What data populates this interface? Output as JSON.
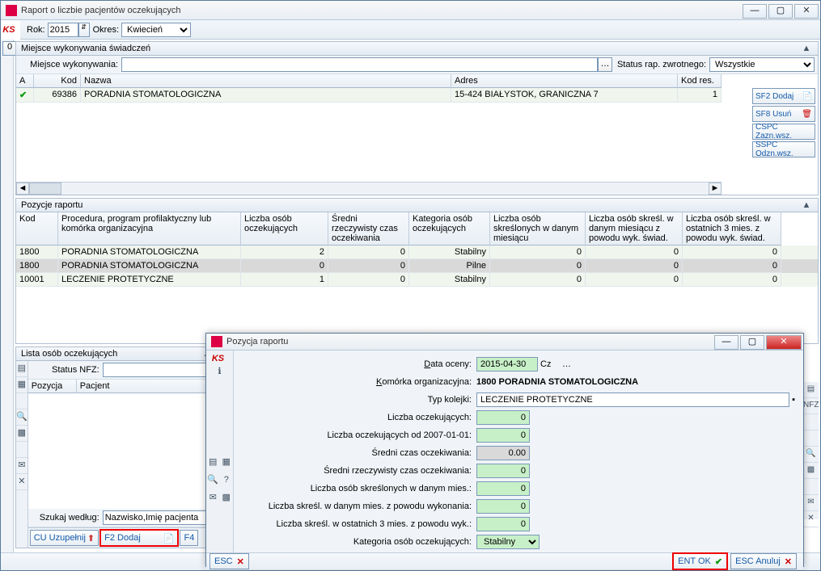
{
  "mainWindow": {
    "title": "Raport o liczbie pacjentów oczekujących"
  },
  "toolbar": {
    "rokLabel": "Rok:",
    "rok": "2015",
    "okresLabel": "Okres:",
    "okres": "Kwiecień",
    "sideNum": "0"
  },
  "miejsce": {
    "panelTitle": "Miejsce wykonywania świadczeń",
    "label": "Miejsce wykonywania:",
    "value": "",
    "statusLabel": "Status rap. zwrotnego:",
    "status": "Wszystkie",
    "headers": {
      "a": "A",
      "kod": "Kod",
      "nazwa": "Nazwa",
      "adres": "Adres",
      "kodres": "Kod res."
    },
    "row": {
      "kod": "69386",
      "nazwa": "PORADNIA STOMATOLOGICZNA",
      "adres": "15-424 BIAŁYSTOK, GRANICZNA 7",
      "kodres": "1"
    }
  },
  "sideButtons": {
    "sf2": "SF2 Dodaj",
    "sf8": "SF8 Usuń",
    "cspc": "CSPC Zazn.wsz.",
    "sspc": "SSPC Odzn.wsz."
  },
  "pozycje": {
    "title": "Pozycje raportu",
    "headers": {
      "kod": "Kod",
      "proc": "Procedura, program profilaktyczny lub komórka organizacyjna",
      "locz": "Liczba osób oczekujących",
      "sred": "Średni rzeczywisty czas oczekiwania",
      "kat": "Kategoria osób oczekujących",
      "skres": "Liczba osób skreślonych w danym miesiącu",
      "skreswyk": "Liczba osób skreśl. w danym miesiącu z powodu wyk. świad.",
      "skres3": "Liczba osób skreśl. w ostatnich 3 mies. z powodu wyk. świad."
    },
    "rows": [
      {
        "kod": "1800",
        "proc": "PORADNIA STOMATOLOGICZNA",
        "locz": "2",
        "sred": "0",
        "kat": "Stabilny",
        "skres": "0",
        "skreswyk": "0",
        "skres3": "0"
      },
      {
        "kod": "1800",
        "proc": "PORADNIA STOMATOLOGICZNA",
        "locz": "0",
        "sred": "0",
        "kat": "Pilne",
        "skres": "0",
        "skreswyk": "0",
        "skres3": "0"
      },
      {
        "kod": "10001",
        "proc": "LECZENIE PROTETYCZNE",
        "locz": "1",
        "sred": "0",
        "kat": "Stabilny",
        "skres": "0",
        "skreswyk": "0",
        "skres3": "0"
      }
    ]
  },
  "lista": {
    "title": "Lista osób oczekujących",
    "statusLabel": "Status NFZ:",
    "status": "",
    "h1": "Pozycja",
    "h2": "Pacjent",
    "szukajLabel": "Szukaj według:",
    "szukaj": "Nazwisko,Imię pacjenta",
    "cu": "CU Uzupełnij",
    "f2": "F2 Dodaj",
    "f4partial": "F4"
  },
  "nfzLabel": "NFZ",
  "modal": {
    "title": "Pozycja raportu",
    "dataLabel": "Data oceny:",
    "data": "2015-04-30",
    "cz": "Cz",
    "komLabel": "Komórka organizacyjna:",
    "kom": "1800 PORADNIA STOMATOLOGICZNA",
    "typLabel": "Typ kolejki:",
    "typ": "LECZENIE PROTETYCZNE",
    "loczLabel": "Liczba oczekujących:",
    "locz": "0",
    "locz07Label": "Liczba oczekujących od 2007-01-01:",
    "locz07": "0",
    "sredLabel": "Średni czas oczekiwania:",
    "sred": "0.00",
    "sredRLabel": "Średni rzeczywisty czas oczekiwania:",
    "sredR": "0",
    "skresLabel": "Liczba osób skreślonych w danym mies.:",
    "skres": "0",
    "skresWLabel": "Liczba skreśl. w danym mies. z powodu wykonania:",
    "skresW": "0",
    "skres3Label": "Liczba skreśl. w ostatnich 3 mies. z powodu wyk.:",
    "skres3": "0",
    "katLabel": "Kategoria osób oczekujących:",
    "kat": "Stabilny",
    "esc": "ESC",
    "entok": "ENT OK",
    "anuluj": "ESC Anuluj"
  }
}
